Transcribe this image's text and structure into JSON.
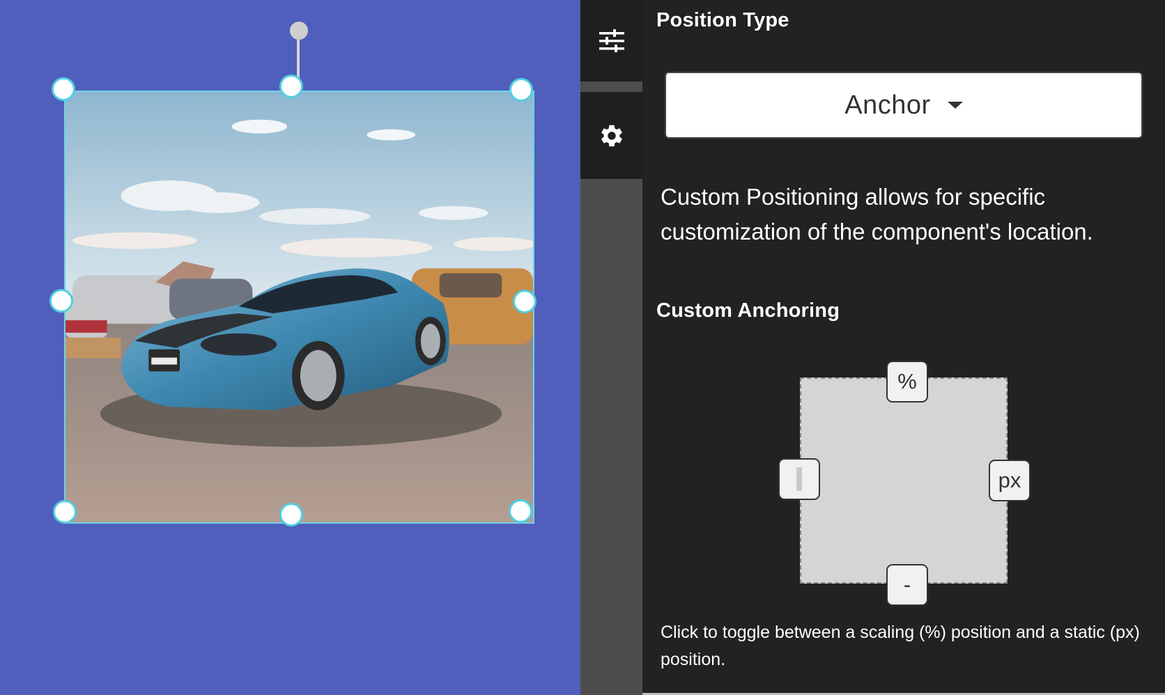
{
  "canvas": {
    "background_color": "#4f5fbb",
    "selection_color": "#4fd0e0",
    "image_subject": "blue sports car photo"
  },
  "rail": {
    "items": [
      {
        "icon": "sliders-icon"
      },
      {
        "icon": "gear-icon"
      }
    ]
  },
  "panel": {
    "position_type_title": "Position Type",
    "position_type_value": "Anchor",
    "description": "Custom Positioning allows for specific customization of the component's location.",
    "custom_anchoring_title": "Custom Anchoring",
    "anchors": {
      "top": "%",
      "right": "px",
      "bottom": "-",
      "left": ""
    },
    "hint": "Click to toggle between a scaling (%) position and a static (px) position."
  }
}
